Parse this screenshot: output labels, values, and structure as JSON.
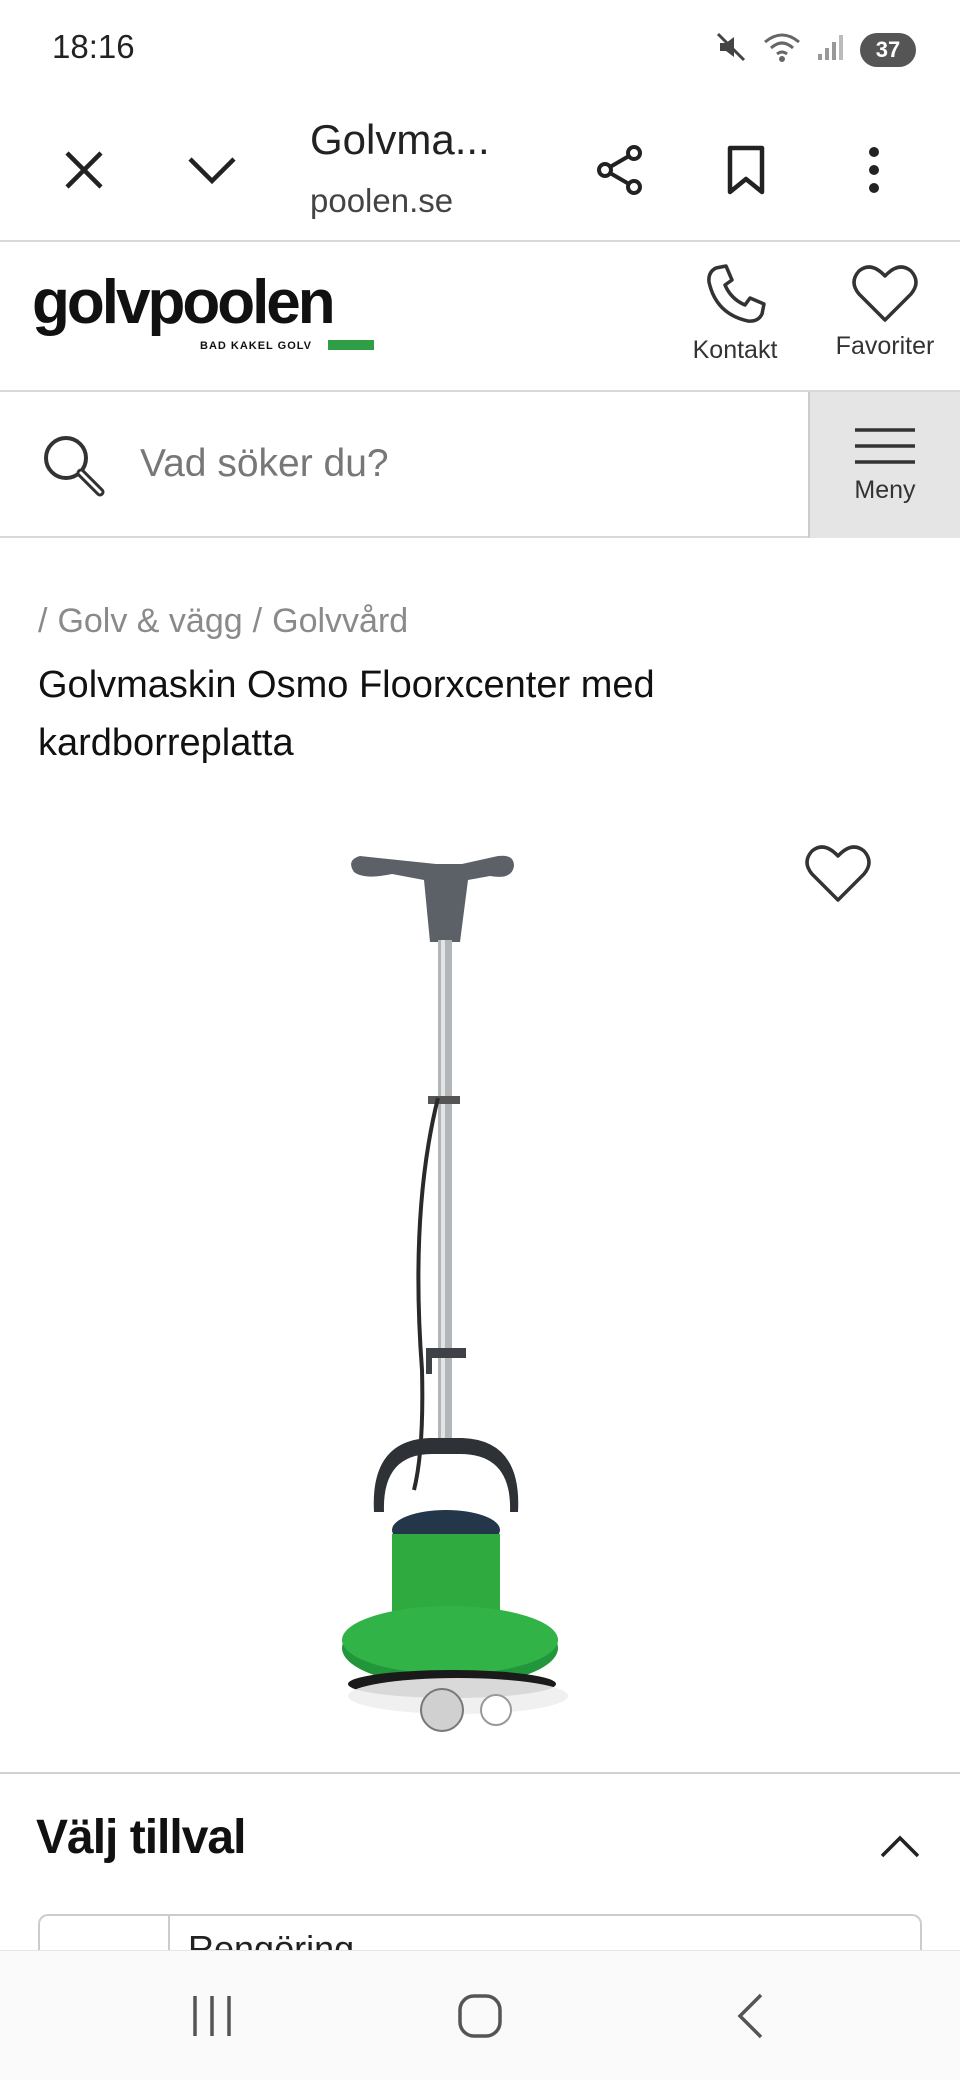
{
  "status_bar": {
    "time": "18:16",
    "battery": "37",
    "icons": [
      "mute-icon",
      "wifi-icon",
      "signal-icon"
    ]
  },
  "browser": {
    "title": "Golvma...",
    "url": "poolen.se",
    "icons": [
      "close-icon",
      "chevron-down-icon",
      "share-icon",
      "bookmark-icon",
      "more-vert-icon"
    ]
  },
  "site_header": {
    "logo_text": "golvpoolen",
    "logo_tagline": "BAD KAKEL GOLV",
    "contact_label": "Kontakt",
    "favorites_label": "Favoriter"
  },
  "search": {
    "placeholder": "Vad söker du?",
    "value": "",
    "menu_label": "Meny"
  },
  "breadcrumb": {
    "items": [
      "Golv & vägg",
      "Golvvård"
    ],
    "separator": "/"
  },
  "product": {
    "title": "Golvmaskin Osmo Floorxcenter med kardborreplatta",
    "image_count": 2,
    "active_image": 1,
    "colors": {
      "body": "#2eaa3f",
      "handle": "#5b6166"
    }
  },
  "options": {
    "heading": "Välj tillval",
    "first_option": "Rengöring"
  }
}
